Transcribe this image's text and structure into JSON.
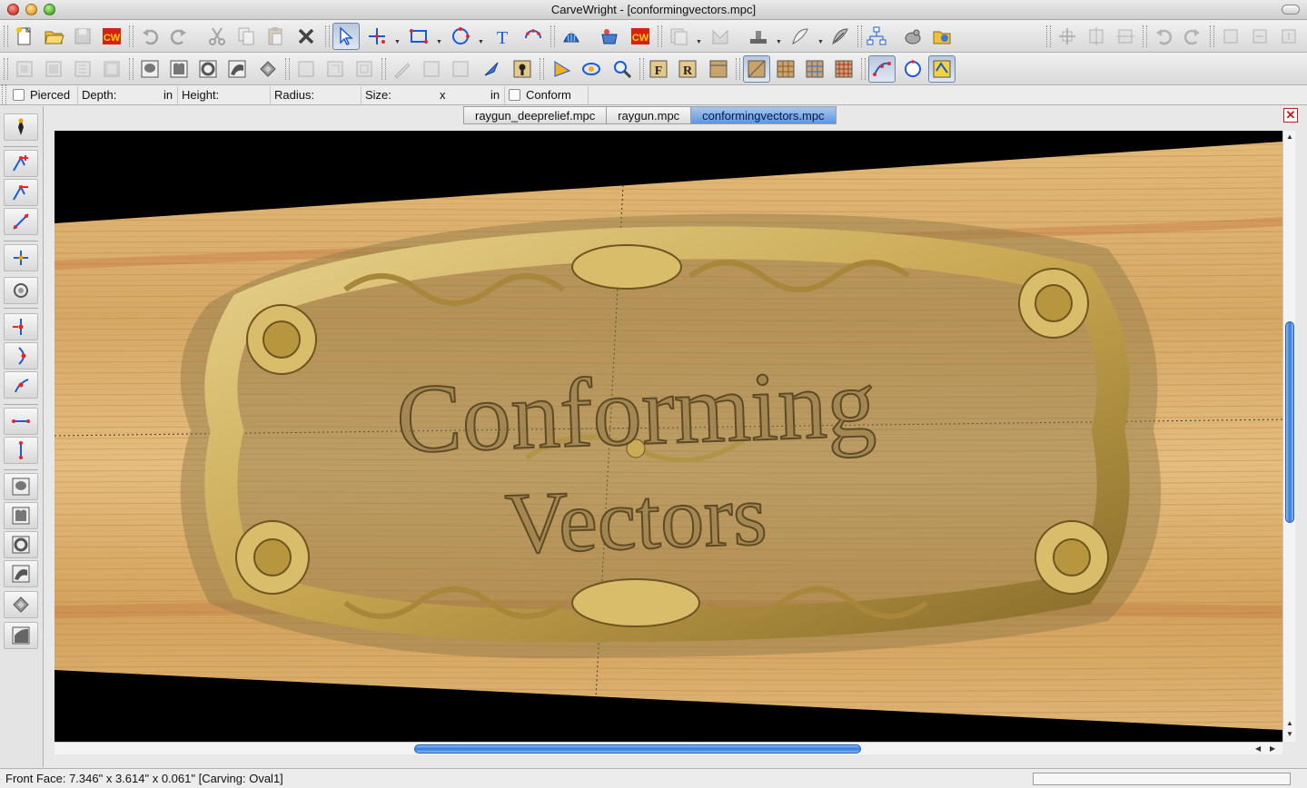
{
  "window": {
    "title": "CarveWright - [conformingvectors.mpc]"
  },
  "toolbar1": {
    "buttons": [
      "new-file-icon",
      "open-file-icon",
      "save-icon",
      "cw-logo-icon",
      "undo-icon",
      "redo-icon",
      "cut-icon",
      "copy-icon",
      "paste-icon",
      "delete-icon",
      "select-arrow-icon",
      "node-edit-icon",
      "rectangle-icon",
      "circle-icon",
      "text-icon",
      "scatter-icon",
      "shell-icon",
      "basket-icon",
      "cw-red-icon",
      "copy-pages-icon",
      "shape-icon",
      "ground-icon",
      "quill-icon",
      "brush-icon",
      "tree-icon",
      "hand-icon",
      "folder-icon"
    ]
  },
  "propbar": {
    "pierced_label": "Pierced",
    "depth_label": "Depth:",
    "depth_unit": "in",
    "height_label": "Height:",
    "radius_label": "Radius:",
    "size_label": "Size:",
    "size_sep": "x",
    "size_unit": "in",
    "conform_label": "Conform"
  },
  "tabs": [
    {
      "label": "raygun_deeprelief.mpc",
      "active": false
    },
    {
      "label": "raygun.mpc",
      "active": false
    },
    {
      "label": "conformingvectors.mpc",
      "active": true
    }
  ],
  "canvas": {
    "line1": "Conforming",
    "line2": "Vectors",
    "board_color": "#d9ad6a",
    "carve_color": "#caa24a"
  },
  "status": {
    "text": "Front Face: 7.346\" x 3.614\" x 0.061\"   [Carving: Oval1]"
  },
  "colors": {
    "accent": "#2f7ae0",
    "close_red": "#cc1111"
  }
}
